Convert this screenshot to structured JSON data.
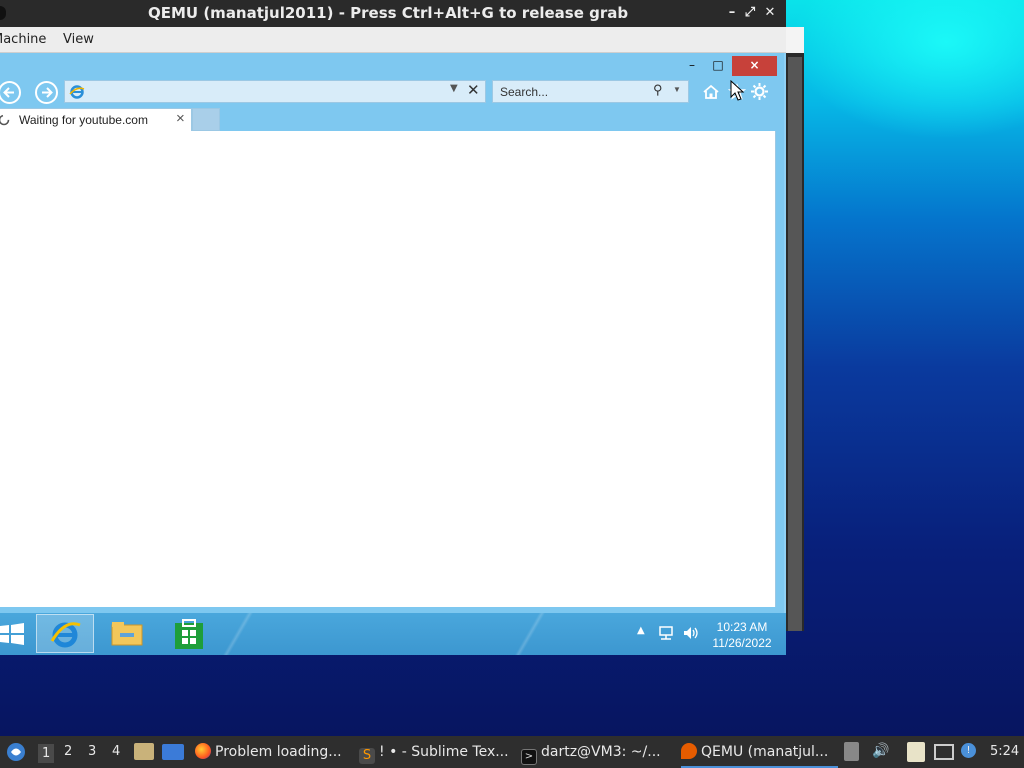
{
  "qemu": {
    "title": "QEMU (manatjul2011) - Press Ctrl+Alt+G to release grab",
    "menu": [
      "Machine",
      "View"
    ],
    "buttons": {
      "minimize": "–",
      "maximize": "⤢",
      "close": "✕"
    }
  },
  "browser": {
    "address_value": "",
    "search_placeholder": "Search...",
    "tab_label": "Waiting for youtube.com",
    "close_tab": "×",
    "window_buttons": {
      "minimize": "–",
      "maximize": "□",
      "close": "×"
    }
  },
  "guest_taskbar": {
    "time": "10:23 AM",
    "date": "11/26/2022",
    "pinned": [
      "internet-explorer",
      "file-explorer",
      "store"
    ]
  },
  "host_taskbar": {
    "workspaces": [
      "1",
      "2",
      "3",
      "4"
    ],
    "tasks": [
      {
        "label": "Problem loading...",
        "icon": "firefox-icon"
      },
      {
        "label": "! • - Sublime Tex...",
        "icon": "sublime-icon"
      },
      {
        "label": "dartz@VM3: ~/...",
        "icon": "terminal-icon"
      },
      {
        "label": "QEMU (manatjul...",
        "icon": "qemu-icon"
      }
    ],
    "clock": "5:24"
  },
  "colors": {
    "ie_frame": "#7ec8f0",
    "close_red": "#c7413a",
    "host_taskbar": "#2e2e2e",
    "guest_taskbar": "#3c97d0"
  }
}
